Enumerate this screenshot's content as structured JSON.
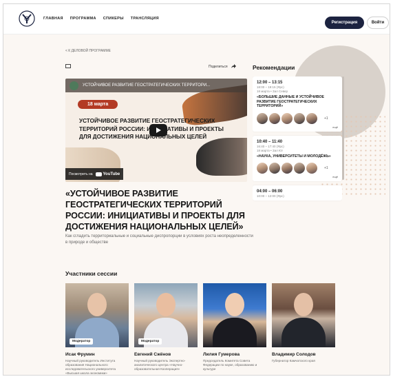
{
  "header": {
    "nav": [
      "ГЛАВНАЯ",
      "ПРОГРАММА",
      "СПИКЕРЫ",
      "ТРАНСЛЯЦИЯ"
    ],
    "register_label": "Регистрация",
    "login_label": "Войти"
  },
  "breadcrumb": "< К ДЕЛОВОЙ ПРОГРАММЕ",
  "share_label": "Поделиться",
  "video": {
    "channel_title": "УСТОЙЧИВОЕ РАЗВИТИЕ ГЕОСТРАТЕГИЧЕСКИХ ТЕРРИТОРИ...",
    "date": "18 марта",
    "title": "УСТОЙЧИВОЕ РАЗВИТИЕ ГЕОСТРАТЕГИЧЕСКИХ ТЕРРИТОРИЙ РОССИИ: ИНИЦИАТИВЫ И ПРОЕКТЫ ДЛЯ ДОСТИЖЕНИЯ НАЦИОНАЛЬНЫХ ЦЕЛЕЙ",
    "watch_on": "Посмотреть на",
    "youtube": "YouTube"
  },
  "session": {
    "title": "«УСТОЙЧИВОЕ РАЗВИТИЕ ГЕОСТРАТЕГИЧЕСКИХ ТЕРРИТОРИЙ РОССИИ: ИНИЦИАТИВЫ И ПРОЕКТЫ ДЛЯ ДОСТИЖЕНИЯ НАЦИОНАЛЬНЫХ ЦЕЛЕЙ»",
    "subtitle": "Как сгладить территориальные и социальные диспропорции в условиях роста неопределенности в природе и обществе"
  },
  "recommendations": {
    "title": "Рекомендации",
    "cards": [
      {
        "time": "12:00 – 13:15",
        "sub": "18:00 – 19:15 (Ярс)",
        "loc": "18 марта • Зал Север",
        "title": "«БОЛЬШИЕ ДАННЫЕ И УСТОЙЧИВОЕ РАЗВИТИЕ ГЕОСТРАТЕГИЧЕСКИХ ТЕРРИТОРИЙ»",
        "more": "+1",
        "more_label": "ещё"
      },
      {
        "time": "10:40 – 11:40",
        "sub": "16:40 – 17:40 (Ярс)",
        "loc": "18 марта • Зал Юг",
        "title": "«НАУКА, УНИВЕРСИТЕТЫ И МОЛОДЁЖЬ»",
        "more": "+1",
        "more_label": "ещё"
      },
      {
        "time": "04:00 – 06:00",
        "sub": "10:00 – 12:00 (Ярс)",
        "loc": "",
        "title": "",
        "more": "",
        "more_label": ""
      }
    ]
  },
  "participants": {
    "title": "Участники сессии",
    "moderator_label": "Модератор",
    "people": [
      {
        "name": "Исак Фрумин",
        "role": "Научный руководитель Института образования Национального исследовательского университета «Высшая школа экономики»"
      },
      {
        "name": "Евгений Сжёнов",
        "role": "Научный руководитель Экспертно-аналитического центра «Научно-образовательная Кооперация»"
      },
      {
        "name": "Лилия Гумерова",
        "role": "Председатель Комитета Совета Федерации по науке, образованию и культуре"
      },
      {
        "name": "Владимир Солодов",
        "role": "Губернатор Камчатского края"
      }
    ]
  }
}
